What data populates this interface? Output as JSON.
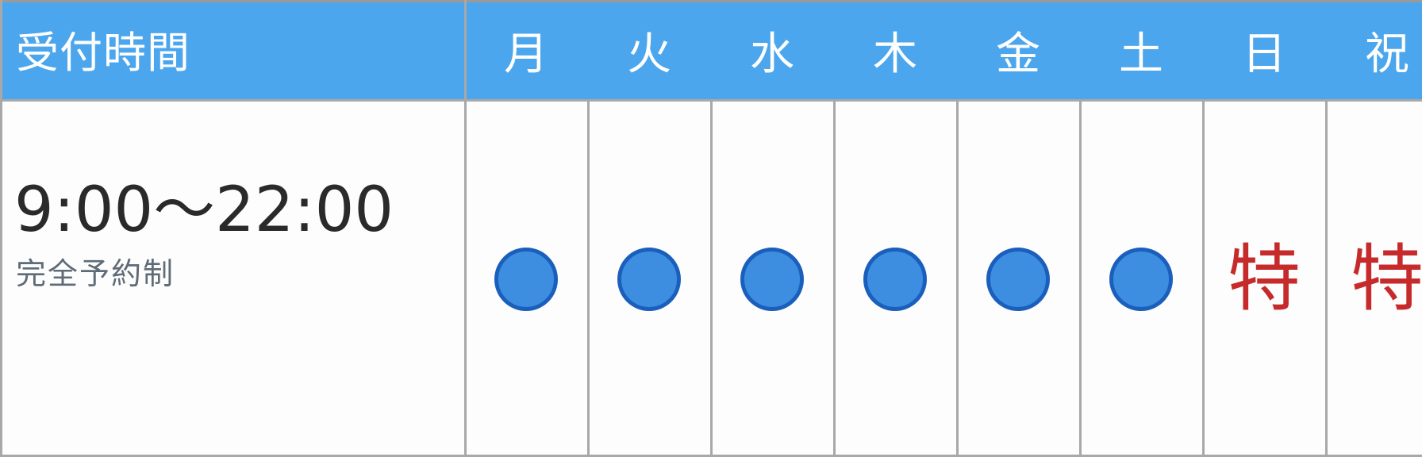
{
  "header": {
    "label": "受付時間"
  },
  "days": [
    {
      "label": "月",
      "mark": "circle"
    },
    {
      "label": "火",
      "mark": "circle"
    },
    {
      "label": "水",
      "mark": "circle"
    },
    {
      "label": "木",
      "mark": "circle"
    },
    {
      "label": "金",
      "mark": "circle"
    },
    {
      "label": "土",
      "mark": "circle"
    },
    {
      "label": "日",
      "mark": "text",
      "text": "特"
    },
    {
      "label": "祝",
      "mark": "text",
      "text": "特"
    }
  ],
  "hours": {
    "time_range": "9:00〜22:00",
    "note": "完全予約制"
  },
  "colors": {
    "header_bg": "#4ba6ee",
    "circle_fill": "#3d8ee0",
    "circle_border": "#1b5fbd",
    "special_text": "#c62a2a"
  }
}
